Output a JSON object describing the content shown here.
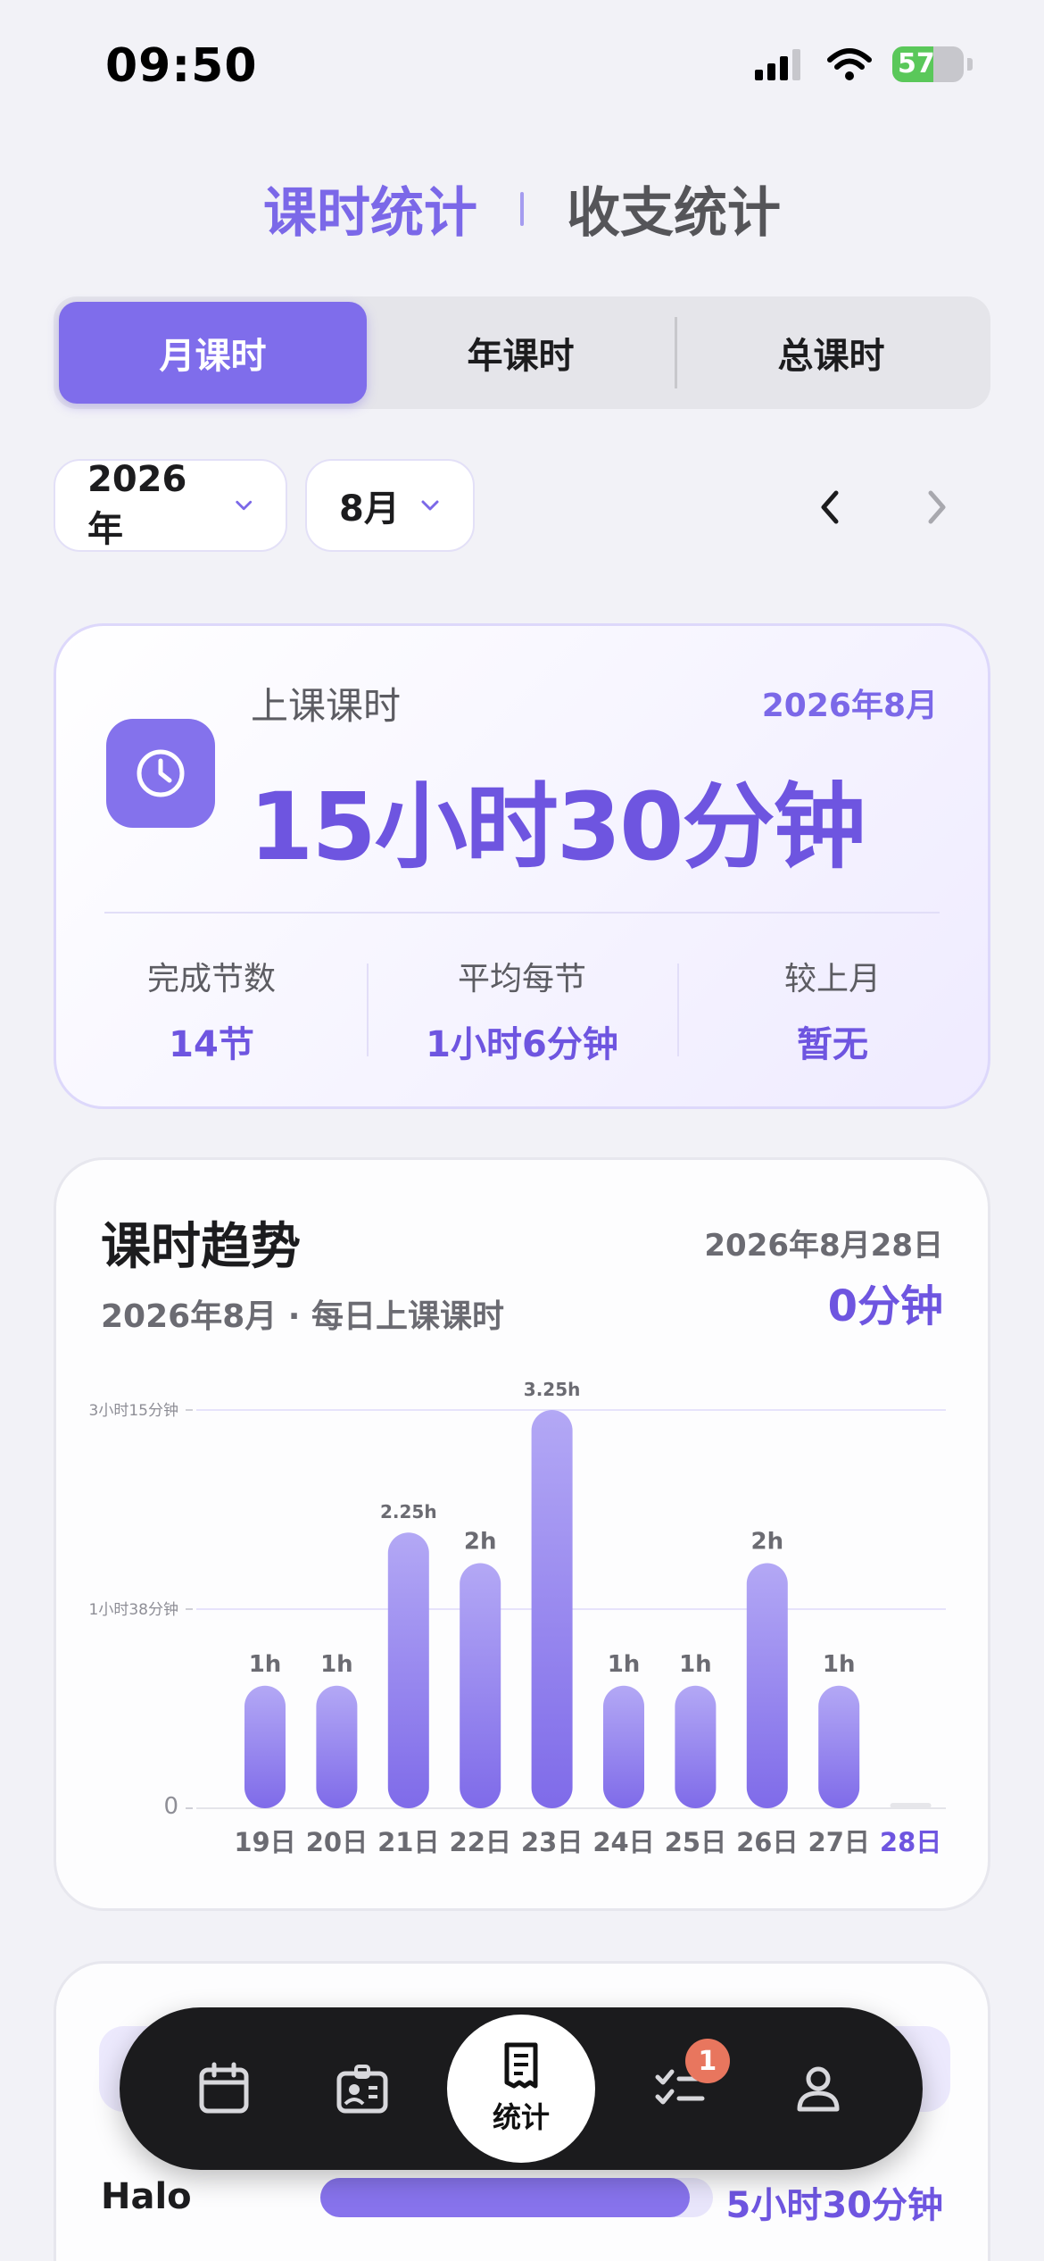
{
  "status": {
    "time": "09:50",
    "battery": "57",
    "battery_level": 0.57
  },
  "top_tabs": [
    {
      "label": "课时统计",
      "active": true
    },
    {
      "label": "收支统计",
      "active": false
    }
  ],
  "period_tabs": [
    {
      "label": "月课时",
      "active": true
    },
    {
      "label": "年课时",
      "active": false
    },
    {
      "label": "总课时",
      "active": false
    }
  ],
  "pickers": {
    "year": "2026年",
    "month": "8月"
  },
  "summary": {
    "label": "上课课时",
    "date": "2026年8月",
    "value": "15小时30分钟",
    "stats": [
      {
        "label": "完成节数",
        "value": "14节"
      },
      {
        "label": "平均每节",
        "value": "1小时6分钟"
      },
      {
        "label": "较上月",
        "value": "暂无"
      }
    ]
  },
  "trend": {
    "title": "课时趋势",
    "subtitle": "2026年8月 · 每日上课课时",
    "selected_date": "2026年8月28日",
    "selected_value": "0分钟"
  },
  "chart_data": {
    "type": "bar",
    "categories": [
      "19日",
      "20日",
      "21日",
      "22日",
      "23日",
      "24日",
      "25日",
      "26日",
      "27日",
      "28日"
    ],
    "values": [
      1,
      1,
      2.25,
      2,
      3.25,
      1,
      1,
      2,
      1,
      0
    ],
    "data_labels": [
      "1h",
      "1h",
      "2.25h",
      "2h",
      "3.25h",
      "1h",
      "1h",
      "2h",
      "1h",
      ""
    ],
    "y_ticks": [
      {
        "value": 0,
        "label": "0"
      },
      {
        "value": 1.625,
        "label": "1小时38分钟"
      },
      {
        "value": 3.25,
        "label": "3小时15分钟"
      }
    ],
    "ylim": [
      0,
      3.25
    ],
    "highlight_category": "28日",
    "bar_color_top": "#b3a8f5",
    "bar_color_bottom": "#7f6be9",
    "grid": true
  },
  "students": [
    {
      "name": "Halo",
      "hours": "5小时30分钟",
      "share": 0.94
    }
  ],
  "tabbar": {
    "items": [
      {
        "icon": "calendar-icon"
      },
      {
        "icon": "id-card-icon"
      },
      {
        "icon": "receipt-icon",
        "label": "统计",
        "active": true
      },
      {
        "icon": "checklist-icon",
        "badge": "1"
      },
      {
        "icon": "person-icon"
      }
    ]
  },
  "colors": {
    "accent": "#7b68e8",
    "accent_dark": "#6e55e0",
    "badge": "#e8765e"
  }
}
